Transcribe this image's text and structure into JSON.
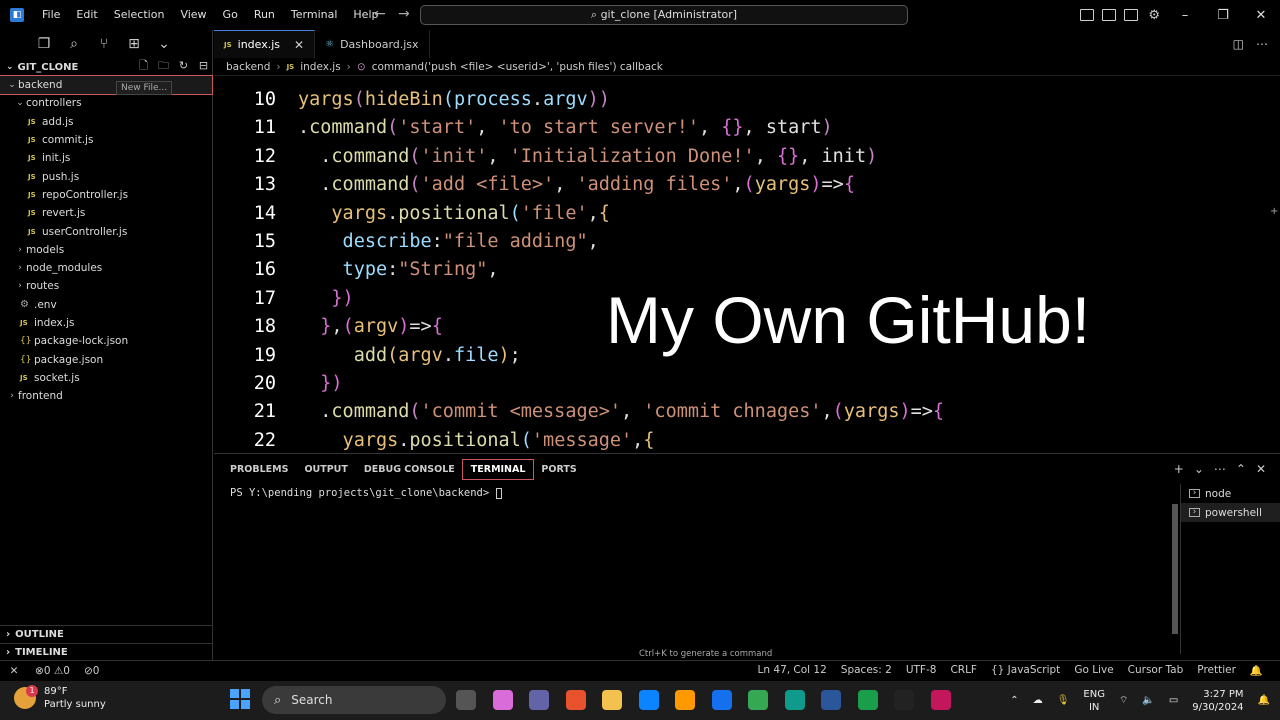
{
  "window": {
    "title": "git_clone [Administrator]",
    "menu": [
      "File",
      "Edit",
      "Selection",
      "View",
      "Go",
      "Run",
      "Terminal",
      "Help"
    ]
  },
  "explorer": {
    "title": "GIT_CLONE",
    "tooltip": "New File...",
    "tree": [
      {
        "label": "backend",
        "type": "folder-open",
        "depth": 0,
        "selected": true
      },
      {
        "label": "controllers",
        "type": "folder-open",
        "depth": 1
      },
      {
        "label": "add.js",
        "type": "js",
        "depth": 2
      },
      {
        "label": "commit.js",
        "type": "js",
        "depth": 2
      },
      {
        "label": "init.js",
        "type": "js",
        "depth": 2
      },
      {
        "label": "push.js",
        "type": "js",
        "depth": 2
      },
      {
        "label": "repoController.js",
        "type": "js",
        "depth": 2
      },
      {
        "label": "revert.js",
        "type": "js",
        "depth": 2
      },
      {
        "label": "userController.js",
        "type": "js",
        "depth": 2
      },
      {
        "label": "models",
        "type": "folder",
        "depth": 1
      },
      {
        "label": "node_modules",
        "type": "folder",
        "depth": 1
      },
      {
        "label": "routes",
        "type": "folder",
        "depth": 1
      },
      {
        "label": ".env",
        "type": "env",
        "depth": 1
      },
      {
        "label": "index.js",
        "type": "js",
        "depth": 1
      },
      {
        "label": "package-lock.json",
        "type": "json",
        "depth": 1
      },
      {
        "label": "package.json",
        "type": "json",
        "depth": 1
      },
      {
        "label": "socket.js",
        "type": "js",
        "depth": 1
      },
      {
        "label": "frontend",
        "type": "folder",
        "depth": 0
      }
    ],
    "outline": "OUTLINE",
    "timeline": "TIMELINE"
  },
  "tabs": [
    {
      "label": "index.js",
      "active": true,
      "icon": "JS"
    },
    {
      "label": "Dashboard.jsx",
      "active": false,
      "icon": "react"
    }
  ],
  "breadcrumb": [
    "backend",
    "index.js",
    "command('push <file> <userid>', 'push files') callback"
  ],
  "editor": {
    "overlay": "My Own GitHub!",
    "lines": [
      {
        "n": "10",
        "tokens": [
          [
            "yargs",
            "t-y"
          ],
          [
            "(",
            "t-p"
          ],
          [
            "hideBin",
            "t-y"
          ],
          [
            "(",
            "t-b"
          ],
          [
            "process",
            "t-b"
          ],
          [
            ".",
            "t-w"
          ],
          [
            "argv",
            "t-b"
          ],
          [
            "))",
            "t-p"
          ]
        ]
      },
      {
        "n": "11",
        "tokens": [
          [
            ".",
            "t-w"
          ],
          [
            "command",
            "t-f"
          ],
          [
            "(",
            "t-p"
          ],
          [
            "'start'",
            "t-s"
          ],
          [
            ", ",
            "t-w"
          ],
          [
            "'to start server!'",
            "t-s"
          ],
          [
            ", ",
            "t-w"
          ],
          [
            "{}",
            "t-pk"
          ],
          [
            ", start",
            "t-w"
          ],
          [
            ")",
            "t-p"
          ]
        ]
      },
      {
        "n": "12",
        "tokens": [
          [
            "  .",
            "t-w"
          ],
          [
            "command",
            "t-f"
          ],
          [
            "(",
            "t-p"
          ],
          [
            "'init'",
            "t-s"
          ],
          [
            ", ",
            "t-w"
          ],
          [
            "'Initialization Done!'",
            "t-s"
          ],
          [
            ", ",
            "t-w"
          ],
          [
            "{}",
            "t-pk"
          ],
          [
            ", init",
            "t-w"
          ],
          [
            ")",
            "t-p"
          ]
        ]
      },
      {
        "n": "13",
        "tokens": [
          [
            "  .",
            "t-w"
          ],
          [
            "command",
            "t-f"
          ],
          [
            "(",
            "t-p"
          ],
          [
            "'add <file>'",
            "t-s"
          ],
          [
            ", ",
            "t-w"
          ],
          [
            "'adding files'",
            "t-s"
          ],
          [
            ",",
            "t-w"
          ],
          [
            "(",
            "t-pk"
          ],
          [
            "yargs",
            "t-y"
          ],
          [
            ")",
            "t-pk"
          ],
          [
            "=>",
            "t-w"
          ],
          [
            "{",
            "t-pk"
          ]
        ]
      },
      {
        "n": "14",
        "tokens": [
          [
            "   yargs",
            "t-y"
          ],
          [
            ".",
            "t-w"
          ],
          [
            "positional",
            "t-f"
          ],
          [
            "(",
            "t-b"
          ],
          [
            "'file'",
            "t-s"
          ],
          [
            ",",
            "t-w"
          ],
          [
            "{",
            "t-y"
          ]
        ]
      },
      {
        "n": "15",
        "tokens": [
          [
            "    describe",
            "t-b"
          ],
          [
            ":",
            "t-w"
          ],
          [
            "\"file adding\"",
            "t-s"
          ],
          [
            ",",
            "t-w"
          ]
        ]
      },
      {
        "n": "16",
        "tokens": [
          [
            "    type",
            "t-b"
          ],
          [
            ":",
            "t-w"
          ],
          [
            "\"String\"",
            "t-s"
          ],
          [
            ",",
            "t-w"
          ]
        ]
      },
      {
        "n": "17",
        "tokens": [
          [
            "   })",
            "t-pk"
          ]
        ]
      },
      {
        "n": "18",
        "tokens": [
          [
            "  }",
            "t-pk"
          ],
          [
            ",",
            "t-w"
          ],
          [
            "(",
            "t-pk"
          ],
          [
            "argv",
            "t-y"
          ],
          [
            ")",
            "t-pk"
          ],
          [
            "=>",
            "t-w"
          ],
          [
            "{",
            "t-pk"
          ]
        ]
      },
      {
        "n": "19",
        "tokens": [
          [
            "     add",
            "t-f"
          ],
          [
            "(",
            "t-y"
          ],
          [
            "argv",
            "t-y"
          ],
          [
            ".",
            "t-w"
          ],
          [
            "file",
            "t-b"
          ],
          [
            ")",
            "t-y"
          ],
          [
            ";",
            "t-w"
          ]
        ]
      },
      {
        "n": "20",
        "tokens": [
          [
            "  })",
            "t-pk"
          ]
        ]
      },
      {
        "n": "21",
        "tokens": [
          [
            "  .",
            "t-w"
          ],
          [
            "command",
            "t-f"
          ],
          [
            "(",
            "t-p"
          ],
          [
            "'commit <message>'",
            "t-s"
          ],
          [
            ", ",
            "t-w"
          ],
          [
            "'commit chnages'",
            "t-s"
          ],
          [
            ",",
            "t-w"
          ],
          [
            "(",
            "t-pk"
          ],
          [
            "yargs",
            "t-y"
          ],
          [
            ")",
            "t-pk"
          ],
          [
            "=>",
            "t-w"
          ],
          [
            "{",
            "t-pk"
          ]
        ]
      },
      {
        "n": "22",
        "tokens": [
          [
            "    yargs",
            "t-y"
          ],
          [
            ".",
            "t-w"
          ],
          [
            "positional",
            "t-f"
          ],
          [
            "(",
            "t-b"
          ],
          [
            "'message'",
            "t-s"
          ],
          [
            ",",
            "t-w"
          ],
          [
            "{",
            "t-y"
          ]
        ]
      }
    ]
  },
  "panel": {
    "tabs": [
      "PROBLEMS",
      "OUTPUT",
      "DEBUG CONSOLE",
      "TERMINAL",
      "PORTS"
    ],
    "active_tab": "TERMINAL",
    "prompt": "PS Y:\\pending projects\\git_clone\\backend> ",
    "hint": "Ctrl+K to generate a command",
    "terminals": [
      "node",
      "powershell"
    ]
  },
  "statusbar": {
    "errors": "0",
    "warnings": "0",
    "ports": "0",
    "items": [
      "Ln 47, Col 12",
      "Spaces: 2",
      "UTF-8",
      "CRLF",
      "{} JavaScript",
      "Go Live",
      "Cursor Tab",
      "Prettier"
    ]
  },
  "taskbar": {
    "weather_temp": "89°F",
    "weather_desc": "Partly sunny",
    "weather_badge": "1",
    "search": "Search",
    "lang_top": "ENG",
    "lang_bottom": "IN",
    "time": "3:27 PM",
    "date": "9/30/2024",
    "app_colors": [
      "#555555",
      "#d96cd9",
      "#6264a7",
      "#e8532d",
      "#f2c14e",
      "#0a84ff",
      "#ff9900",
      "#1570ef",
      "#34a853",
      "#0e9b8c",
      "#2b579a",
      "#1b9e4b",
      "#222222",
      "#c2185b"
    ]
  }
}
